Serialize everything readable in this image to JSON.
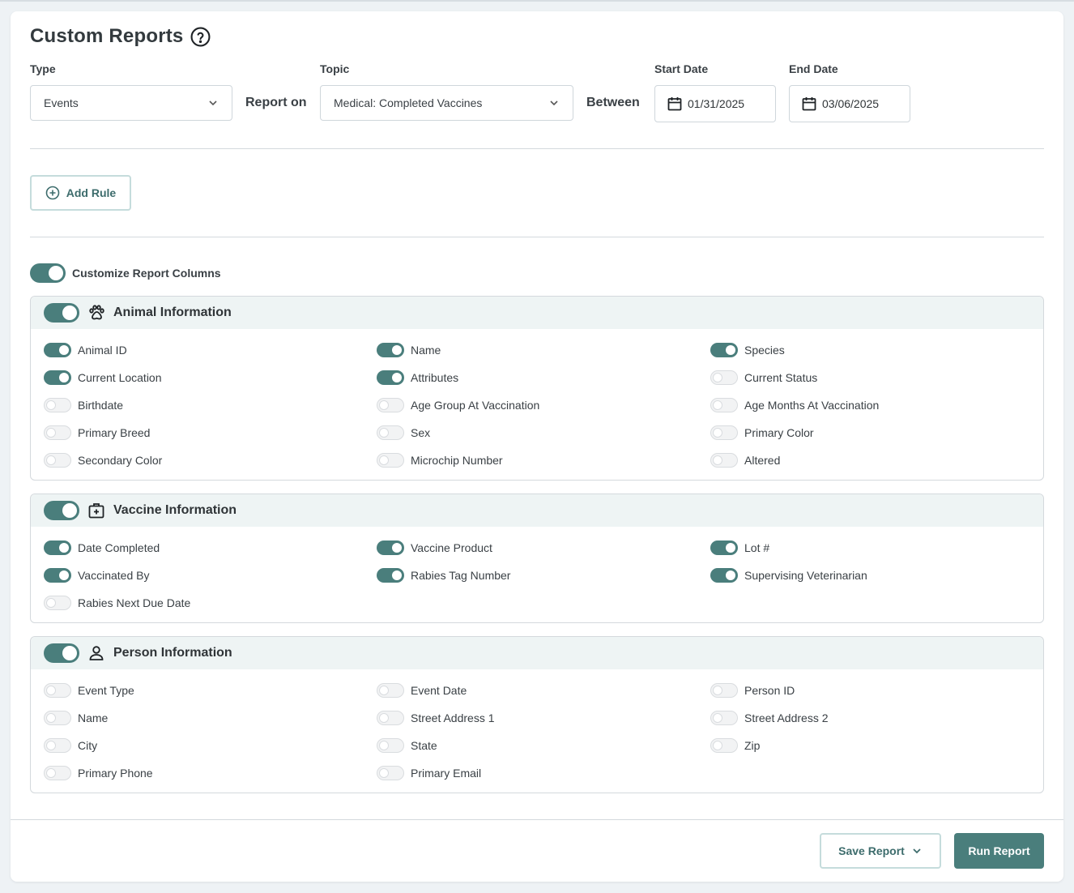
{
  "header": {
    "title": "Custom Reports",
    "help_icon": "question-circle-icon"
  },
  "filters": {
    "type_label": "Type",
    "type_value": "Events",
    "report_on_label": "Report on",
    "topic_label": "Topic",
    "topic_value": "Medical: Completed Vaccines",
    "between_label": "Between",
    "start_label": "Start Date",
    "start_value": "01/31/2025",
    "end_label": "End Date",
    "end_value": "03/06/2025"
  },
  "add_rule_label": "Add Rule",
  "customize": {
    "label": "Customize Report Columns",
    "on": true
  },
  "sections": {
    "animal": {
      "title": "Animal Information",
      "icon": "paw-icon",
      "on": true,
      "items": [
        {
          "label": "Animal ID",
          "on": true
        },
        {
          "label": "Name",
          "on": true
        },
        {
          "label": "Species",
          "on": true
        },
        {
          "label": "Current Location",
          "on": true
        },
        {
          "label": "Attributes",
          "on": true
        },
        {
          "label": "Current Status",
          "on": false
        },
        {
          "label": "Birthdate",
          "on": false
        },
        {
          "label": "Age Group At Vaccination",
          "on": false
        },
        {
          "label": "Age Months At Vaccination",
          "on": false
        },
        {
          "label": "Primary Breed",
          "on": false
        },
        {
          "label": "Sex",
          "on": false
        },
        {
          "label": "Primary Color",
          "on": false
        },
        {
          "label": "Secondary Color",
          "on": false
        },
        {
          "label": "Microchip Number",
          "on": false
        },
        {
          "label": "Altered",
          "on": false
        }
      ]
    },
    "vaccine": {
      "title": "Vaccine Information",
      "icon": "medical-kit-icon",
      "on": true,
      "items": [
        {
          "label": "Date Completed",
          "on": true
        },
        {
          "label": "Vaccine Product",
          "on": true
        },
        {
          "label": "Lot #",
          "on": true
        },
        {
          "label": "Vaccinated By",
          "on": true
        },
        {
          "label": "Rabies Tag Number",
          "on": true
        },
        {
          "label": "Supervising Veterinarian",
          "on": true
        },
        {
          "label": "Rabies Next Due Date",
          "on": false
        }
      ]
    },
    "person": {
      "title": "Person Information",
      "icon": "person-icon",
      "on": true,
      "items": [
        {
          "label": "Event Type",
          "on": false
        },
        {
          "label": "Event Date",
          "on": false
        },
        {
          "label": "Person ID",
          "on": false
        },
        {
          "label": "Name",
          "on": false
        },
        {
          "label": "Street Address 1",
          "on": false
        },
        {
          "label": "Street Address 2",
          "on": false
        },
        {
          "label": "City",
          "on": false
        },
        {
          "label": "State",
          "on": false
        },
        {
          "label": "Zip",
          "on": false
        },
        {
          "label": "Primary Phone",
          "on": false
        },
        {
          "label": "Primary Email",
          "on": false
        }
      ]
    }
  },
  "footer": {
    "save_label": "Save Report",
    "run_label": "Run Report"
  },
  "colors": {
    "accent": "#4a7e7c",
    "section_header_bg": "#eef4f4",
    "page_bg": "#eef2f5"
  }
}
